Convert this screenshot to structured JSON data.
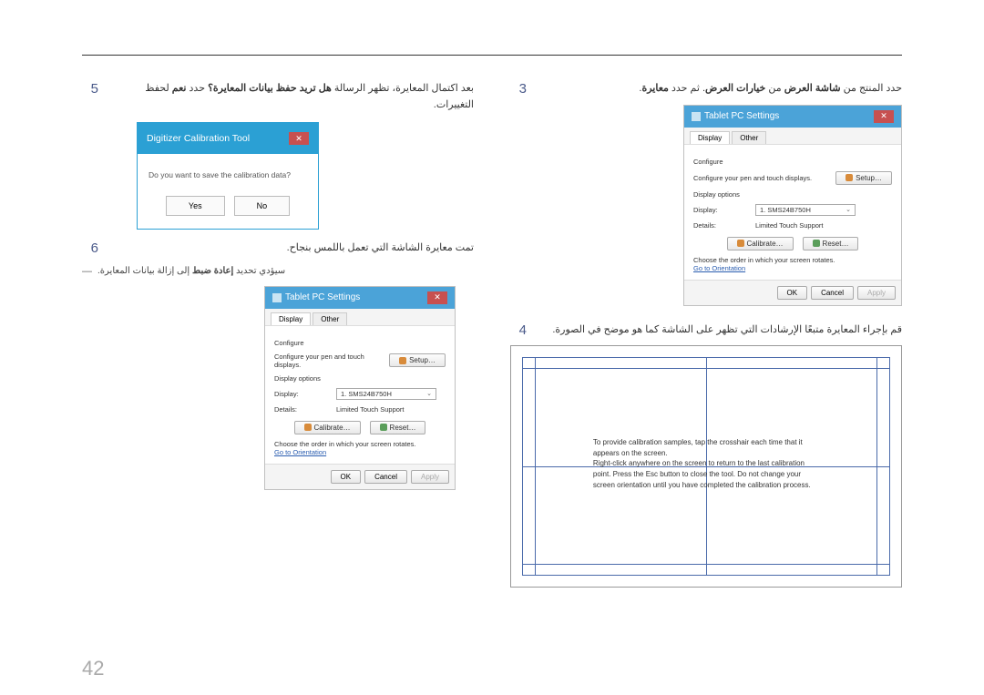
{
  "page_number": "42",
  "steps": {
    "s3": {
      "num": "3",
      "text_pre": "حدد المنتج من ",
      "bold1": "شاشة العرض",
      "mid": " من ",
      "bold2": "خيارات العرض",
      "post": ". ثم حدد ",
      "bold3": "معايرة",
      "end": "."
    },
    "s4": {
      "num": "4",
      "text": "قم بإجراء المعايرة متبعًا الإرشادات التي تظهر على الشاشة كما هو موضح في الصورة."
    },
    "s5": {
      "num": "5",
      "pre": "بعد اكتمال المعايرة، تظهر الرسالة ",
      "bold1": "هل تريد حفظ بيانات المعايرة؟",
      "mid": " حدد ",
      "bold2": "نعم",
      "post": " لحفظ التغييرات."
    },
    "s6": {
      "num": "6",
      "text": "تمت معايرة الشاشة التي تعمل باللمس بنجاح."
    }
  },
  "note": {
    "dash": "―",
    "pre": "سيؤدي تحديد ",
    "bold": "إعادة ضبط",
    "post": " إلى إزالة بيانات المعايرة."
  },
  "tablet_dialog": {
    "title": "Tablet PC Settings",
    "tabs": {
      "display": "Display",
      "other": "Other"
    },
    "configure_label": "Configure",
    "configure_text": "Configure your pen and touch displays.",
    "setup_btn": "Setup…",
    "display_options": "Display options",
    "display_label": "Display:",
    "display_value": "1. SMS24B750H",
    "details_label": "Details:",
    "details_value": "Limited Touch Support",
    "calibrate_btn": "Calibrate…",
    "reset_btn": "Reset…",
    "orientation_note": "Choose the order in which your screen rotates.",
    "orientation_link": "Go to Orientation",
    "ok": "OK",
    "cancel": "Cancel",
    "apply": "Apply"
  },
  "calib_dialog": {
    "title": "Digitizer Calibration Tool",
    "message": "Do you want to save the calibration data?",
    "yes": "Yes",
    "no": "No"
  },
  "calib_screen": {
    "message": "To provide calibration samples, tap the crosshair each time that it appears on the screen.\nRight-click anywhere on the screen to return to the last calibration point. Press the Esc button to close the tool. Do not change your screen orientation until you have completed the calibration process."
  },
  "icons": {
    "close": "✕",
    "chevron_down": "⌄"
  }
}
